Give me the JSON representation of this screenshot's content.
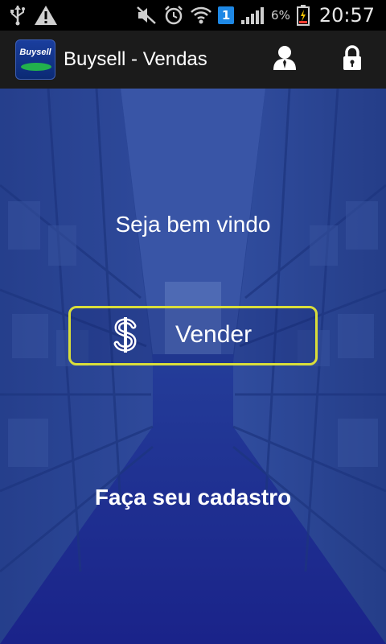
{
  "status_bar": {
    "icons": [
      "usb-icon",
      "warning-icon",
      "mute-icon",
      "alarm-icon",
      "wifi-icon",
      "signal-icon",
      "battery-charging-icon"
    ],
    "notification_badge": "1",
    "battery": "6%",
    "time": "20:57"
  },
  "action_bar": {
    "logo_text": "Buysell",
    "title": "Buysell - Vendas",
    "actions": [
      "user-icon",
      "lock-icon"
    ]
  },
  "main": {
    "welcome": "Seja bem vindo",
    "sell_button": {
      "icon": "dollar-icon",
      "label": "Vender"
    },
    "register_link": "Faça seu cadastro"
  },
  "colors": {
    "status_bar_bg": "#000000",
    "action_bar_bg": "#1b1b1b",
    "background_blue": "#1e2489",
    "button_border": "#d9de3a",
    "text": "#ffffff"
  }
}
